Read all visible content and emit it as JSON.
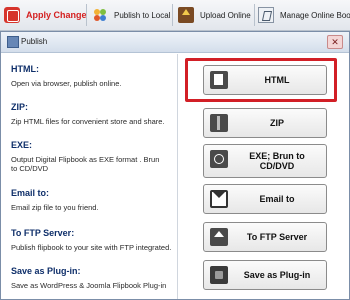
{
  "toolbar": {
    "apply_change": "Apply Change",
    "publish_local": "Publish to Local",
    "upload_online": "Upload Online",
    "manage_books": "Manage Online Books"
  },
  "dialog": {
    "title": "Publish",
    "close_symbol": "✕"
  },
  "options": [
    {
      "title": "HTML:",
      "desc": "Open via browser, publish online.",
      "button": "HTML",
      "icon": "html-file-icon"
    },
    {
      "title": "ZIP:",
      "desc": "Zip HTML files for convenient store and share.",
      "button": "ZIP",
      "icon": "zip-icon"
    },
    {
      "title": "EXE:",
      "desc": "Output Digital Flipbook as EXE format . Brun to CD/DVD",
      "button": "EXE; Brun to CD/DVD",
      "icon": "exe-disc-icon"
    },
    {
      "title": "Email to:",
      "desc": "Email zip file to you friend.",
      "button": "Email to",
      "icon": "envelope-icon"
    },
    {
      "title": "To FTP Server:",
      "desc": "Publish flipbook to your site with FTP integrated.",
      "button": "To FTP Server",
      "icon": "ftp-upload-icon"
    },
    {
      "title": "Save as Plug-in:",
      "desc": "Save as WordPress & Joomla Flipbook Plug-in",
      "button": "Save as Plug-in",
      "icon": "plugin-icon"
    }
  ],
  "colors": {
    "highlight": "#d21f26",
    "title_text": "#0f2f6a",
    "apply_text": "#d41f1f"
  }
}
